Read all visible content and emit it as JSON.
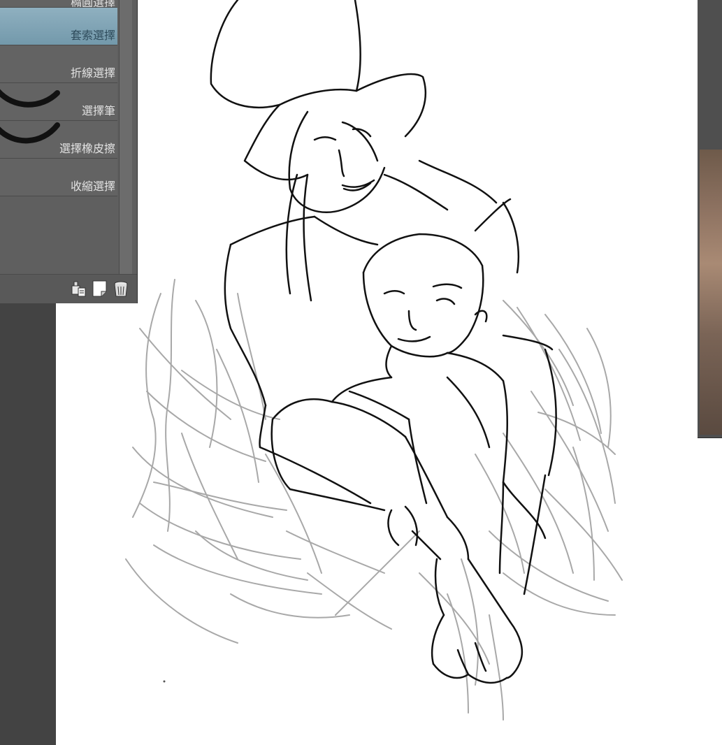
{
  "tool_panel": {
    "items": [
      {
        "label": "橢圓選擇",
        "icon": "ellipse-select-icon",
        "selected": false
      },
      {
        "label": "套索選擇",
        "icon": "lasso-select-icon",
        "selected": true
      },
      {
        "label": "折線選擇",
        "icon": "polyline-select-icon",
        "selected": false
      },
      {
        "label": "選擇筆",
        "icon": "selection-pen-icon",
        "selected": false
      },
      {
        "label": "選擇橡皮擦",
        "icon": "selection-eraser-icon",
        "selected": false
      },
      {
        "label": "收縮選擇",
        "icon": "shrink-selection-icon",
        "selected": false
      }
    ],
    "footer_icons": [
      "copy-sub-tool-icon",
      "create-sub-tool-icon",
      "delete-sub-tool-icon"
    ]
  },
  "canvas": {
    "content": "sketch-drawing",
    "colors": {
      "ink": "#111111",
      "rough_sketch": "#a8a8a8",
      "paper": "#ffffff"
    }
  },
  "colors": {
    "panel_bg": "#5f5f5f",
    "selected_item": "#7fa3b5",
    "dark_frame": "#434343"
  }
}
